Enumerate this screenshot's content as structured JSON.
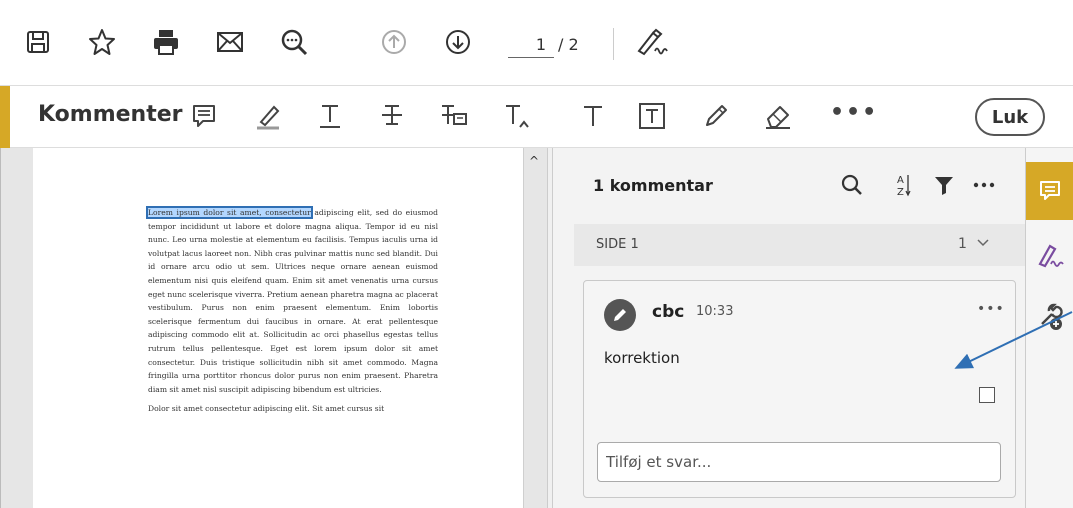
{
  "toolbar": {
    "page_current": "1",
    "page_total": "/ 2",
    "icons": [
      "save-icon",
      "star-icon",
      "print-icon",
      "mail-icon",
      "zoom-search-icon",
      "page-up-icon",
      "page-down-icon",
      "sign-icon"
    ]
  },
  "comment_toolbar": {
    "title": "Kommenter",
    "more": "•••",
    "close_label": "Luk",
    "tools": [
      "sticky-note-icon",
      "highlight-icon",
      "underline-icon",
      "strikethrough-icon",
      "replace-text-icon",
      "insert-text-icon",
      "add-text-icon",
      "text-box-icon",
      "draw-icon",
      "eraser-icon"
    ]
  },
  "document": {
    "highlighted": "Lorem ipsum dolor sit amet, consectetur",
    "para1_rest": " adipiscing elit, sed do eiusmod tempor incididunt ut labore et dolore magna aliqua. Tempor id eu nisl nunc. Leo urna molestie at elementum eu facilisis. Tempus iaculis urna id volutpat lacus laoreet non. Nibh cras pulvinar mattis nunc sed blandit. Dui id ornare arcu odio ut sem. Ultrices neque ornare aenean euismod elementum nisi quis eleifend quam. Enim sit amet venenatis urna cursus eget nunc scelerisque viverra. Pretium aenean pharetra magna ac placerat vestibulum. Purus non enim praesent elementum. Enim lobortis scelerisque fermentum dui faucibus in ornare. At erat pellentesque adipiscing commodo elit at. Sollicitudin ac orci phasellus egestas tellus rutrum tellus pellentesque. Eget est lorem ipsum dolor sit amet consectetur. Duis tristique sollicitudin nibh sit amet commodo. Magna fringilla urna porttitor rhoncus dolor purus non enim praesent. Pharetra diam sit amet nisl suscipit adipiscing bibendum est ultricies.",
    "para2": "Dolor sit amet consectetur adipiscing elit. Sit amet cursus sit"
  },
  "panel": {
    "title": "1 kommentar",
    "page_label": "SIDE 1",
    "page_count": "1",
    "comment": {
      "author": "cbc",
      "time": "10:33",
      "more": "•••",
      "text": "korrektion",
      "reply_placeholder": "Tilføj et svar..."
    }
  },
  "colors": {
    "accent": "#d6a826",
    "highlight": "#b3d7ff",
    "highlight_border": "#2f6fb4",
    "arrow": "#2f6fb4"
  }
}
